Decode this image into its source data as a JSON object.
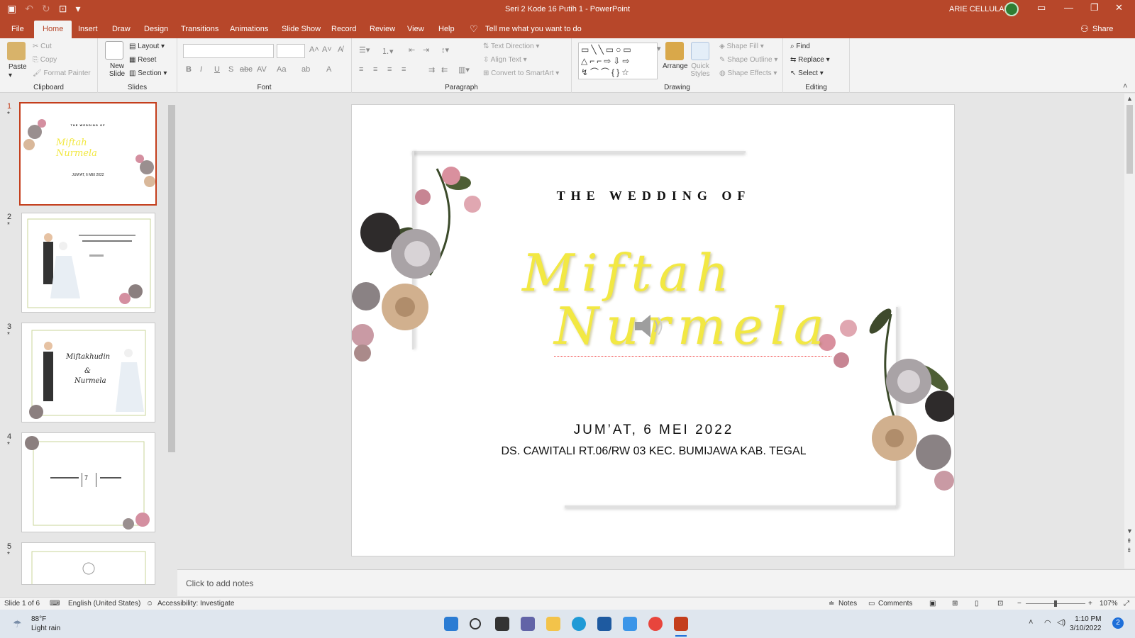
{
  "window": {
    "title": "Seri 2 Kode 16 Putih 1  -  PowerPoint",
    "user": "ARIE CELLULAR"
  },
  "tabs": [
    "File",
    "Home",
    "Insert",
    "Draw",
    "Design",
    "Transitions",
    "Animations",
    "Slide Show",
    "Record",
    "Review",
    "View",
    "Help"
  ],
  "tellme": "Tell me what you want to do",
  "share": "Share",
  "ribbon": {
    "clipboard": {
      "paste": "Paste",
      "cut": "Cut",
      "copy": "Copy",
      "format_painter": "Format Painter",
      "label": "Clipboard"
    },
    "slides": {
      "new_slide": "New Slide",
      "layout": "Layout",
      "reset": "Reset",
      "section": "Section",
      "label": "Slides"
    },
    "font": {
      "label": "Font",
      "b": "B",
      "i": "I",
      "u": "U",
      "s": "S",
      "abc": "abc",
      "av": "AV",
      "aa": "Aa",
      "a": "A"
    },
    "paragraph": {
      "text_direction": "Text Direction",
      "align_text": "Align Text",
      "convert_smartart": "Convert to SmartArt",
      "label": "Paragraph"
    },
    "drawing": {
      "arrange": "Arrange",
      "quick_styles": "Quick Styles",
      "shape_fill": "Shape Fill",
      "shape_outline": "Shape Outline",
      "shape_effects": "Shape Effects",
      "label": "Drawing"
    },
    "editing": {
      "find": "Find",
      "replace": "Replace",
      "select": "Select",
      "label": "Editing"
    }
  },
  "thumbnails": [
    {
      "num": "1",
      "star": "*"
    },
    {
      "num": "2",
      "star": "*"
    },
    {
      "num": "3",
      "star": "*"
    },
    {
      "num": "4",
      "star": "*"
    },
    {
      "num": "5",
      "star": "*"
    }
  ],
  "slide": {
    "heading": "THE WEDDING OF",
    "name1": "Miftah",
    "name2": "Nurmela",
    "date": "JUM’AT, 6 MEI 2022",
    "address": "DS. CAWITALI RT.06/RW 03 KEC. BUMIJAWA KAB. TEGAL"
  },
  "thumb_text": {
    "t1_heading": "THE WEDDING OF",
    "t1_names": "Miftah Nurmela",
    "t1_date": "JUM’AT, 6 MEI 2022",
    "t3_name1": "Miftakhudin",
    "t3_amp": "&",
    "t3_name2": "Nurmela",
    "t4_day": "7"
  },
  "notes_placeholder": "Click to add notes",
  "status": {
    "slide": "Slide 1 of 6",
    "language": "English (United States)",
    "accessibility": "Accessibility: Investigate",
    "notes": "Notes",
    "comments": "Comments",
    "zoom": "107%"
  },
  "taskbar": {
    "temp": "88°F",
    "weather": "Light rain",
    "time": "1:10 PM",
    "date": "3/10/2022",
    "badge": "2"
  },
  "colors": {
    "accent": "#b7472a",
    "name_yellow": "#f2e843"
  }
}
